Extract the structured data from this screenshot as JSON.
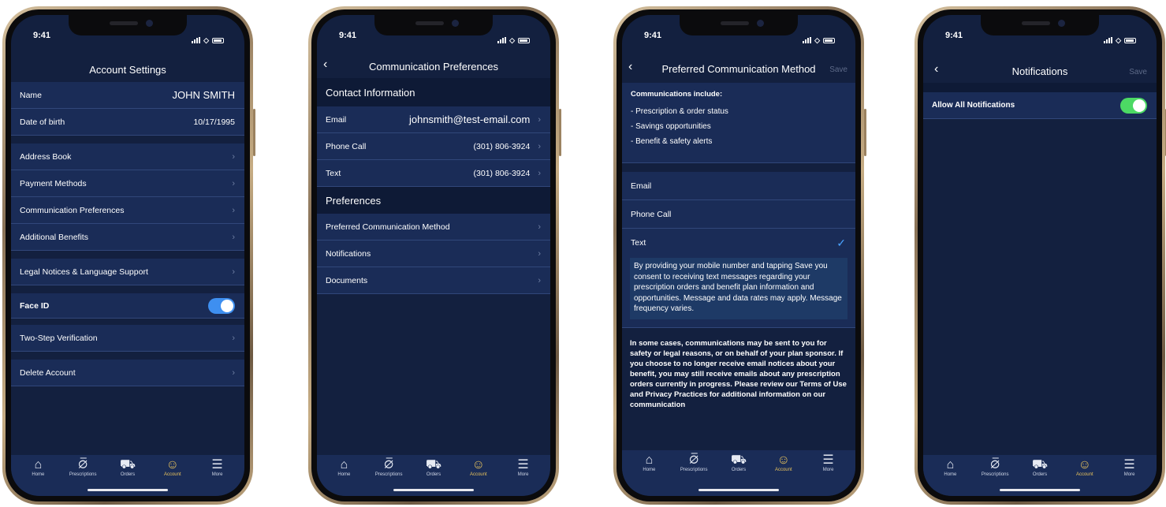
{
  "status_time": "9:41",
  "colors": {
    "toggle_blue": "#3e8ff0",
    "toggle_green": "#4cd964",
    "accent_gold": "#e7c25d",
    "check_blue": "#4aa3ff"
  },
  "tabs": [
    {
      "label": "Home",
      "icon": "home-icon"
    },
    {
      "label": "Prescriptions",
      "icon": "pill-icon"
    },
    {
      "label": "Orders",
      "icon": "truck-icon"
    },
    {
      "label": "Account",
      "icon": "person-icon",
      "active": true
    },
    {
      "label": "More",
      "icon": "menu-icon"
    }
  ],
  "screen1": {
    "title": "Account Settings",
    "name_label": "Name",
    "name_value": "JOHN SMITH",
    "dob_label": "Date of birth",
    "dob_value": "10/17/1995",
    "address_book": "Address Book",
    "payment_methods": "Payment Methods",
    "communication_preferences": "Communication Preferences",
    "additional_benefits": "Additional Benefits",
    "legal_notices": "Legal Notices & Language Support",
    "face_id": "Face ID",
    "two_step": "Two-Step Verification",
    "delete_account": "Delete Account"
  },
  "screen2": {
    "title": "Communication Preferences",
    "contact_header": "Contact Information",
    "email_label": "Email",
    "email_value": "johnsmith@test-email.com",
    "phone_label": "Phone Call",
    "phone_value": "(301) 806-3924",
    "text_label": "Text",
    "text_value": "(301) 806-3924",
    "preferences_header": "Preferences",
    "preferred_method": "Preferred Communication Method",
    "notifications": "Notifications",
    "documents": "Documents"
  },
  "screen3": {
    "title": "Preferred Communication Method",
    "save": "Save",
    "includes_heading": "Communications include:",
    "includes": [
      "- Prescription & order status",
      "- Savings opportunities",
      "- Benefit & safety alerts"
    ],
    "option_email": "Email",
    "option_phone": "Phone Call",
    "option_text": "Text",
    "consent": "By providing your mobile number and tapping Save you consent to receiving text messages regarding your prescription orders and benefit plan information and opportunities. Message and data rates may apply. Message frequency varies.",
    "legal": "In some cases, communications may be sent to you for safety or legal reasons, or on behalf of your plan sponsor. If you choose to no longer receive email notices about your benefit, you may still receive emails about any prescription orders currently in progress. Please review our Terms of Use and Privacy Practices for additional information on our communication"
  },
  "screen4": {
    "title": "Notifications",
    "save": "Save",
    "allow_all": "Allow All Notifications"
  }
}
